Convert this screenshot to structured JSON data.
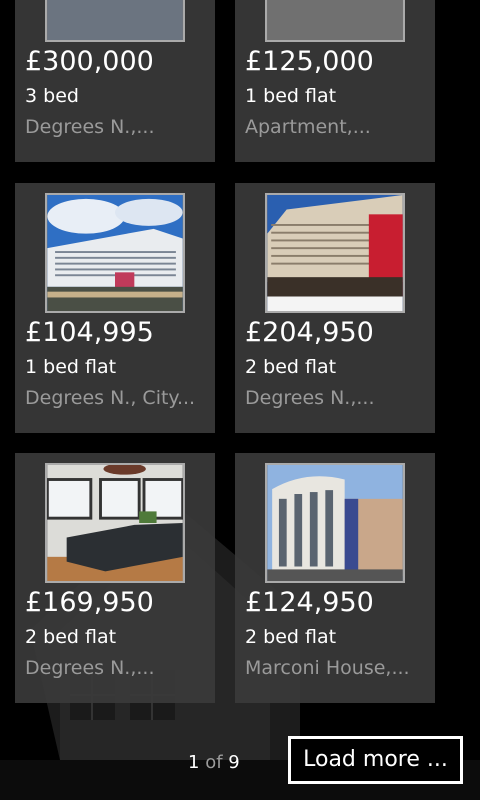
{
  "listings": [
    {
      "price": "£300,000",
      "beds": "3 bed",
      "address": "Degrees N.,..."
    },
    {
      "price": "£125,000",
      "beds": "1 bed flat",
      "address": "Apartment,..."
    },
    {
      "price": "£104,995",
      "beds": "1 bed flat",
      "address": "Degrees N., City..."
    },
    {
      "price": "£204,950",
      "beds": "2 bed flat",
      "address": "Degrees N.,..."
    },
    {
      "price": "£169,950",
      "beds": "2 bed flat",
      "address": "Degrees N.,..."
    },
    {
      "price": "£124,950",
      "beds": "2 bed flat",
      "address": "Marconi House,..."
    }
  ],
  "pagination": {
    "current": "1",
    "of": "of",
    "total": "9"
  },
  "load_more_label": "Load more ...",
  "colors": {
    "background": "#000000",
    "card": "#3a3a3a",
    "secondary_text": "#9a9a9a"
  }
}
